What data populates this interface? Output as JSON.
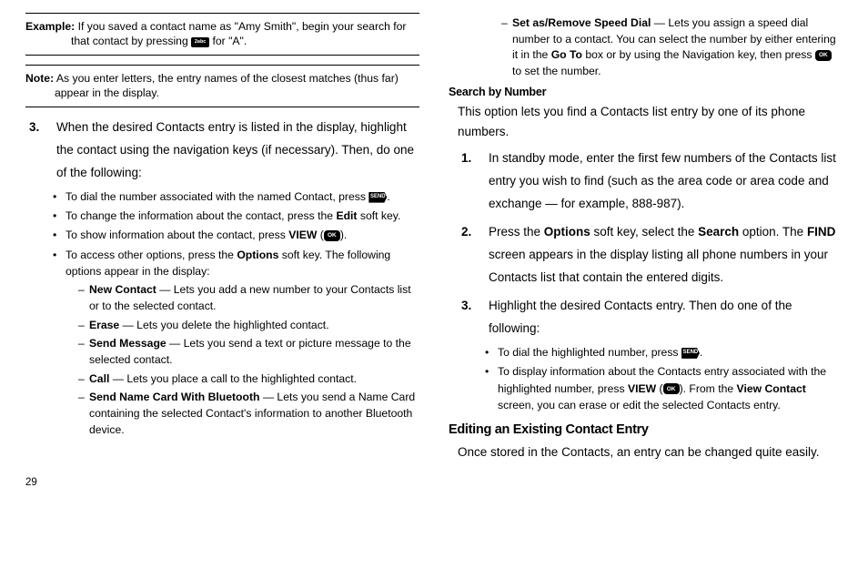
{
  "left": {
    "exampleLabel": "Example:",
    "exampleText1": " If you saved a contact name as \"Amy Smith\", begin your search for",
    "exampleText2": "that contact by pressing ",
    "exampleText3": " for \"A\".",
    "noteLabel": "Note:",
    "noteText1": " As you enter letters, the entry names of the closest matches (thus far)",
    "noteText2": "appear in the display.",
    "step3Num": "3.",
    "step3Text": "When the desired Contacts entry is listed in the display, highlight the contact using the navigation keys (if necessary). Then, do one of the following:",
    "b1a": "To dial the number associated with the named Contact, press ",
    "b1b": ".",
    "b2a": "To change the information about the contact, press the ",
    "b2bold": "Edit",
    "b2b": " soft key.",
    "b3a": "To show information about the contact, press ",
    "b3bold": "VIEW",
    "b3b": " (",
    "b3c": ").",
    "b4a": "To access other options, press the ",
    "b4bold": "Options",
    "b4b": " soft key. The following options appear in the display:",
    "d1bold": "New Contact",
    "d1text": " — Lets you add a new number to your Contacts list or to the selected contact.",
    "d2bold": "Erase",
    "d2text": " — Lets you delete the highlighted contact.",
    "d3bold": "Send Message",
    "d3text": " — Lets you send a text or picture message to the selected contact.",
    "d4bold": "Call",
    "d4text": " — Lets you place a call to the highlighted contact.",
    "d5bold": "Send Name Card With Bluetooth",
    "d5text": " — Lets you send a Name Card containing the selected Contact's information to another Bluetooth device."
  },
  "right": {
    "dTopBold": "Set as/Remove Speed Dial",
    "dTopText1": " — Lets you assign a speed dial number to a contact. You can select the number by either entering it in the ",
    "dTopBold2": "Go To",
    "dTopText2": " box or by using the Navigation key, then press ",
    "dTopText3": " to set the number.",
    "sub1": "Search by Number",
    "para1": "This option lets you find a Contacts list entry by one of its phone numbers.",
    "s1Num": "1.",
    "s1Text": "In standby mode, enter the first few numbers of the Contacts list entry you wish to find (such as the area code or area code and exchange — for example, 888-987).",
    "s2Num": "2.",
    "s2a": "Press the ",
    "s2bold1": "Options",
    "s2b": " soft key, select the ",
    "s2bold2": "Search",
    "s2c": " option. The ",
    "s2bold3": "FIND",
    "s2d": " screen appears in the display listing all phone numbers in your Contacts list that contain the entered digits.",
    "s3Num": "3.",
    "s3Text": "Highlight the desired Contacts entry. Then do one of the following:",
    "rb1a": "To dial the highlighted number, press ",
    "rb1b": ".",
    "rb2a": "To display information about the Contacts entry associated with the highlighted number, press ",
    "rb2bold1": "VIEW",
    "rb2b": " (",
    "rb2c": "). From the ",
    "rb2bold2": "View Contact",
    "rb2d": " screen, you can erase or edit the selected Contacts entry.",
    "section": "Editing an Existing Contact Entry",
    "para2": "Once stored in the Contacts, an entry can be changed quite easily."
  },
  "pageNumber": "29",
  "icons": {
    "abc": "2abc",
    "send": "SEND",
    "ok": "OK"
  }
}
